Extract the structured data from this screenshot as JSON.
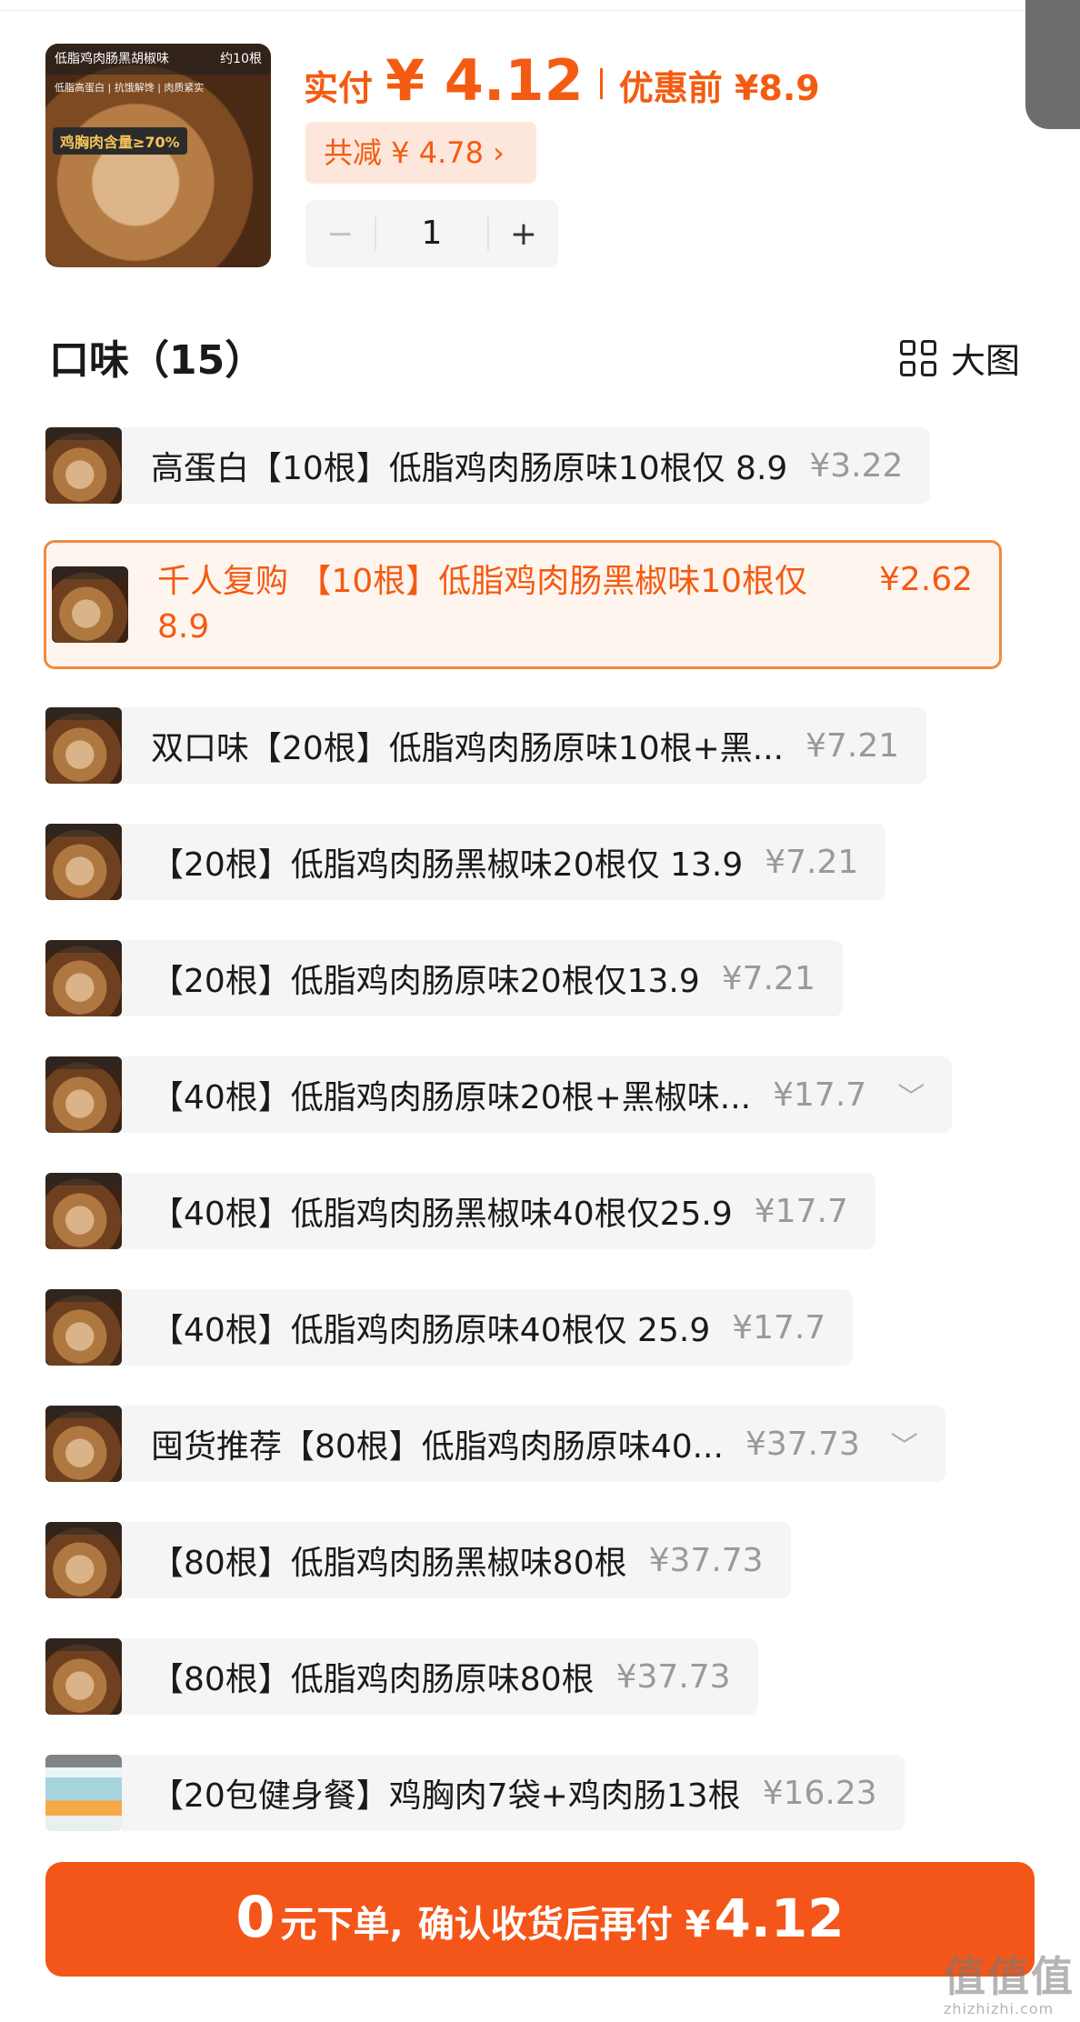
{
  "product": {
    "thumb_title": "低脂鸡肉肠黑胡椒味",
    "thumb_count": "约10根",
    "thumb_tags": "低脂高蛋白 | 抗饿解馋 | 肉质紧实",
    "thumb_badge": "鸡胸肉含量≥70%",
    "paid_label": "实付",
    "paid_amount": "¥ 4.12",
    "before_label": "优惠前 ¥8.9",
    "discount": "共减 ¥ 4.78 ›",
    "quantity": "1",
    "minus": "−",
    "plus": "+"
  },
  "section": {
    "title": "口味（15）",
    "view_toggle": "大图"
  },
  "options": [
    {
      "text": "高蛋白【10根】低脂鸡肉肠原味10根仅 8.9",
      "price": "¥3.22"
    },
    {
      "text": "千人复购 【10根】低脂鸡肉肠黑椒味10根仅 8.9",
      "price": "¥2.62",
      "selected": true
    },
    {
      "text": "双口味【20根】低脂鸡肉肠原味10根+黑...",
      "price": "¥7.21"
    },
    {
      "text": "【20根】低脂鸡肉肠黑椒味20根仅 13.9",
      "price": "¥7.21"
    },
    {
      "text": "【20根】低脂鸡肉肠原味20根仅13.9",
      "price": "¥7.21"
    },
    {
      "text": "【40根】低脂鸡肉肠原味20根+黑椒味...",
      "price": "¥17.7",
      "chevron": "﹀"
    },
    {
      "text": "【40根】低脂鸡肉肠黑椒味40根仅25.9",
      "price": "¥17.7"
    },
    {
      "text": "【40根】低脂鸡肉肠原味40根仅 25.9",
      "price": "¥17.7"
    },
    {
      "text": "囤货推荐【80根】低脂鸡肉肠原味40...",
      "price": "¥37.73",
      "chevron": "﹀"
    },
    {
      "text": "【80根】低脂鸡肉肠黑椒味80根",
      "price": "¥37.73"
    },
    {
      "text": "【80根】低脂鸡肉肠原味80根",
      "price": "¥37.73"
    },
    {
      "text": "【20包健身餐】鸡胸肉7袋+鸡肉肠13根",
      "price": "¥16.23"
    }
  ],
  "order_button": {
    "zero": "0",
    "yuan": "元下单,",
    "rest": "确认收货后再付 ¥",
    "amount": "4.12"
  },
  "watermark": {
    "main": "值值值",
    "sub": "zhizhizhi.com"
  }
}
